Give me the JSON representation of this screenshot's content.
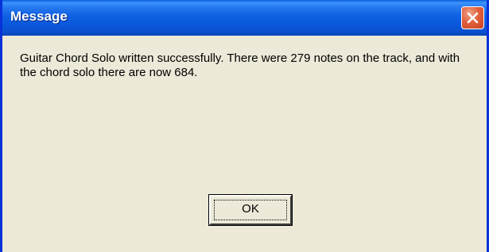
{
  "window": {
    "title": "Message",
    "close_icon": "close-icon"
  },
  "message": {
    "text": "Guitar Chord Solo written successfully. There were 279 notes on the track, and with the chord solo there are now 684."
  },
  "buttons": {
    "ok_label": "OK"
  },
  "colors": {
    "titlebar": "#0a58dc",
    "client_background": "#ece9d8",
    "close_button": "#e2603e"
  }
}
